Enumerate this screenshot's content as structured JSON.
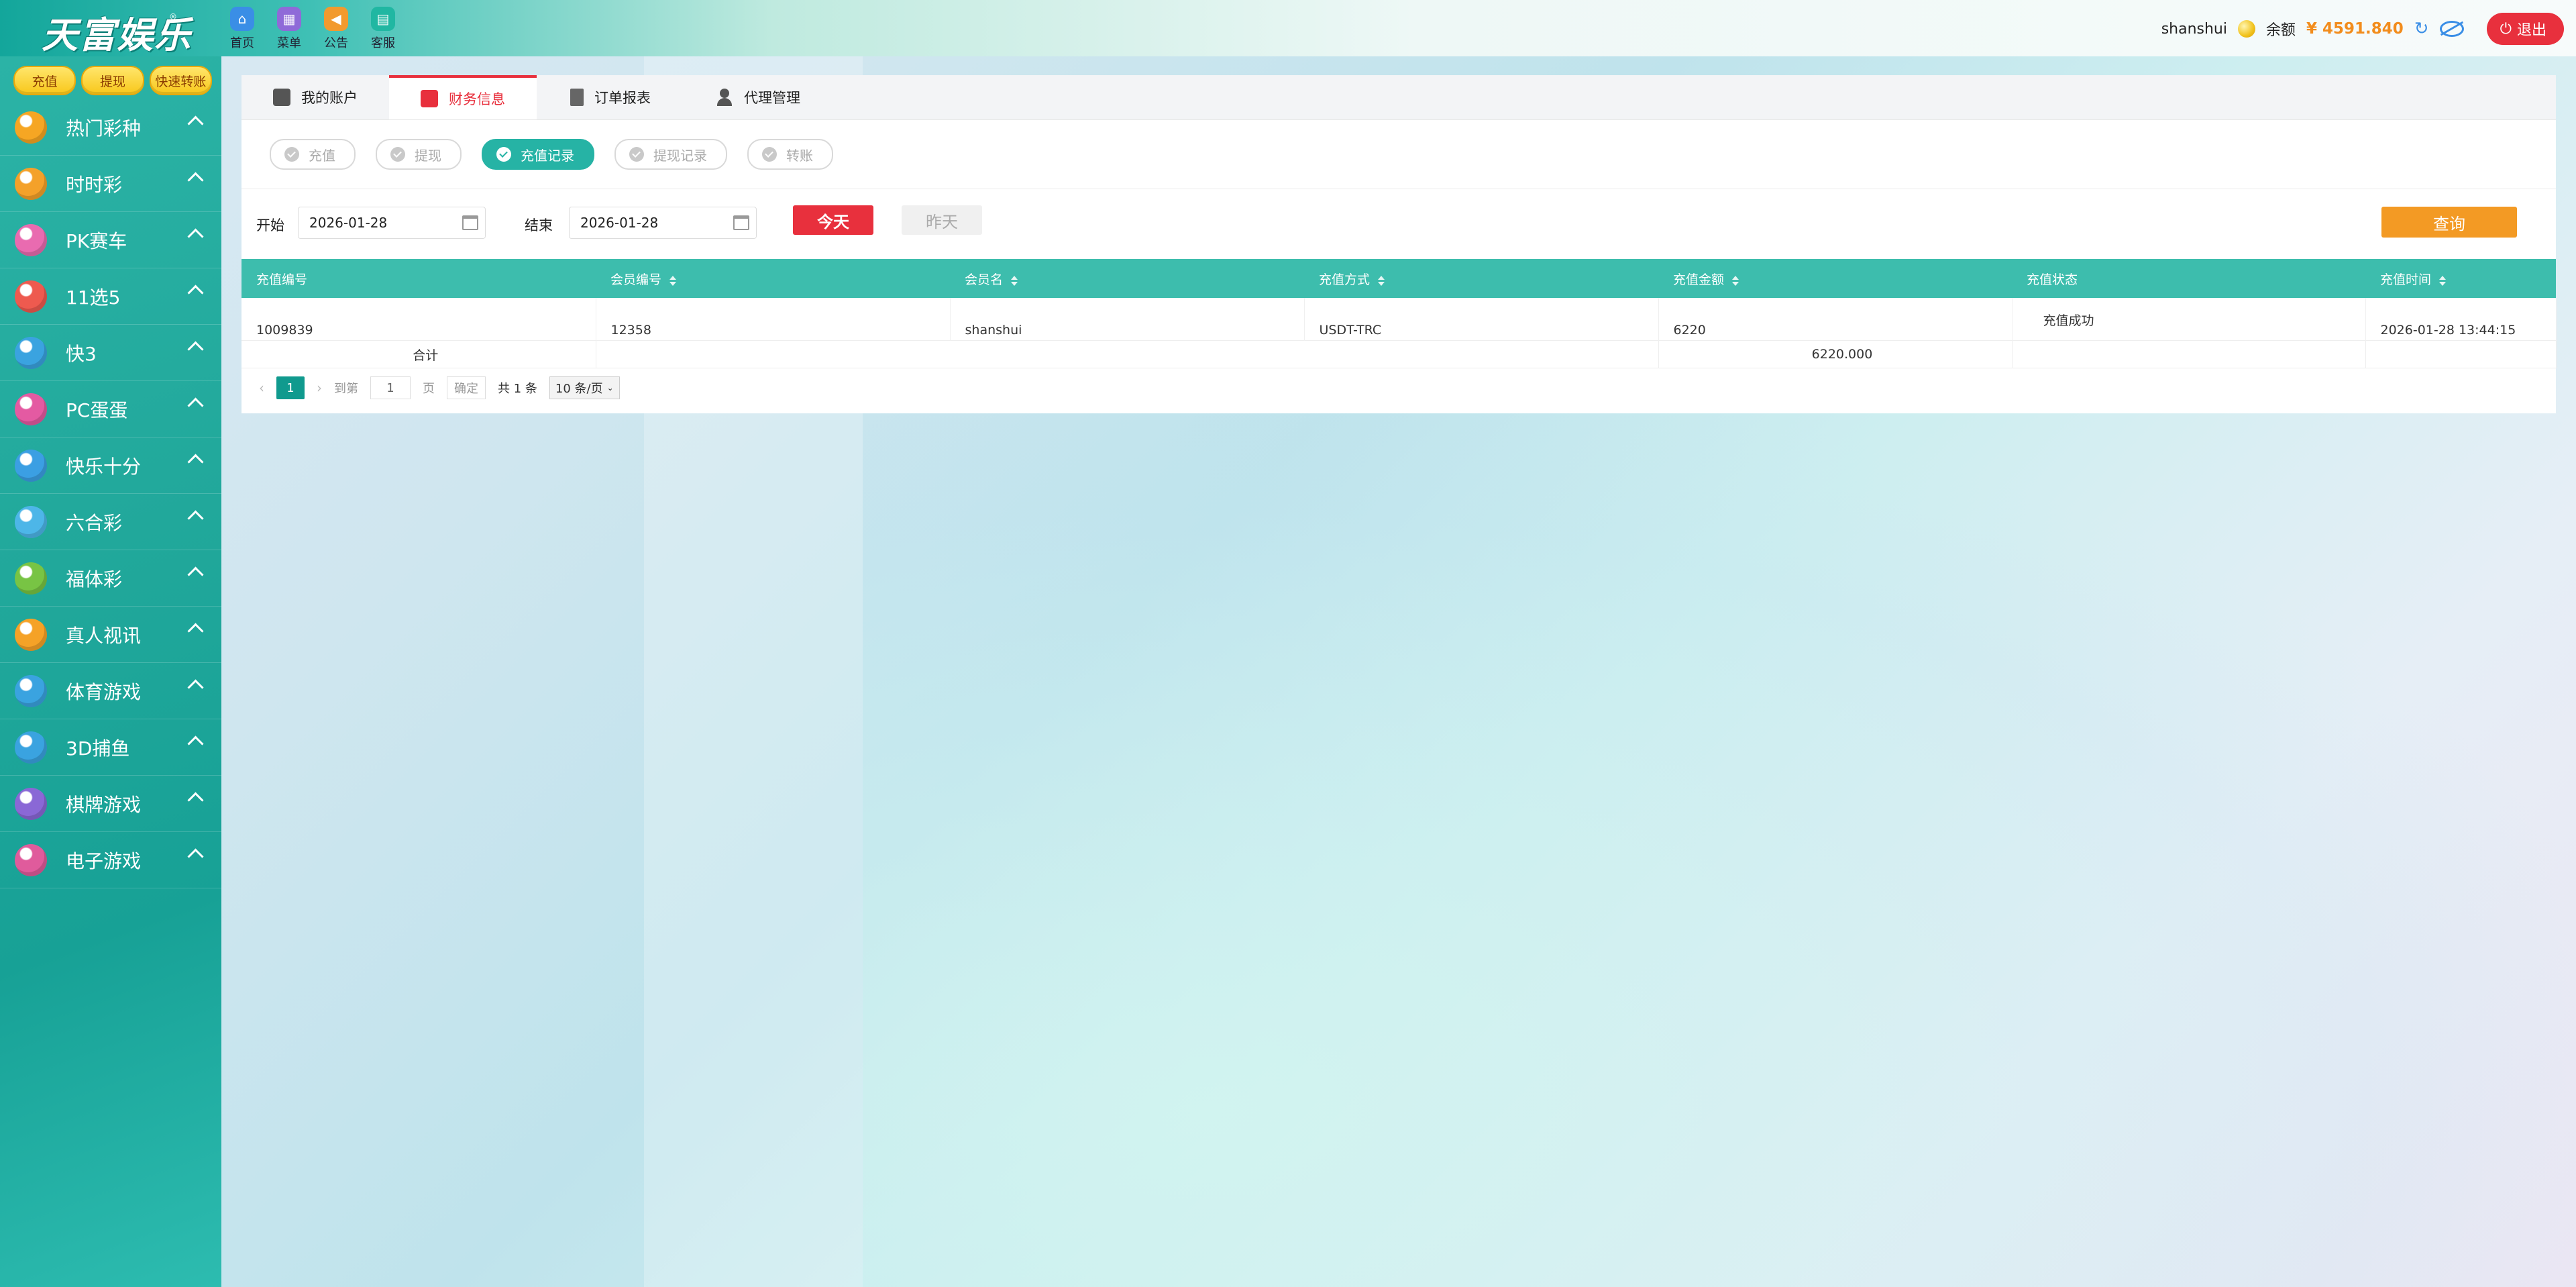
{
  "app": {
    "logo": "天富娱乐",
    "logo_reg": "®"
  },
  "topnav": [
    {
      "label": "首页",
      "icon": "home-icon"
    },
    {
      "label": "菜单",
      "icon": "grid-menu-icon"
    },
    {
      "label": "公告",
      "icon": "megaphone-icon"
    },
    {
      "label": "客服",
      "icon": "chat-icon"
    }
  ],
  "user": {
    "name": "shanshui",
    "balance_label": "余额",
    "balance": "¥ 4591.840",
    "logout": "退出"
  },
  "quick": {
    "deposit": "充值",
    "withdraw": "提现",
    "transfer": "快速转账"
  },
  "sidebar": {
    "items": [
      {
        "label": "热门彩种",
        "color": "#f6a623"
      },
      {
        "label": "时时彩",
        "color": "#f4a12a"
      },
      {
        "label": "PK赛车",
        "color": "#e96bb0"
      },
      {
        "label": "11选5",
        "color": "#ee5a4f"
      },
      {
        "label": "快3",
        "color": "#3aa3e0"
      },
      {
        "label": "PC蛋蛋",
        "color": "#e45aa2"
      },
      {
        "label": "快乐十分",
        "color": "#3b9fe3"
      },
      {
        "label": "六合彩",
        "color": "#4db6e8"
      },
      {
        "label": "福体彩",
        "color": "#78c444"
      },
      {
        "label": "真人视讯",
        "color": "#f5a227"
      },
      {
        "label": "体育游戏",
        "color": "#3aa3e0"
      },
      {
        "label": "3D捕鱼",
        "color": "#3aa3e0"
      },
      {
        "label": "棋牌游戏",
        "color": "#8a68d6"
      },
      {
        "label": "电子游戏",
        "color": "#e05b9c"
      }
    ]
  },
  "tabs": [
    {
      "label": "我的账户"
    },
    {
      "label": "财务信息"
    },
    {
      "label": "订单报表"
    },
    {
      "label": "代理管理"
    }
  ],
  "subtabs": [
    {
      "label": "充值"
    },
    {
      "label": "提现"
    },
    {
      "label": "充值记录"
    },
    {
      "label": "提现记录"
    },
    {
      "label": "转账"
    }
  ],
  "filter": {
    "start_label": "开始",
    "start_date": "2026-01-28",
    "end_label": "结束",
    "end_date": "2026-01-28",
    "today": "今天",
    "yesterday": "昨天",
    "query": "查询"
  },
  "table": {
    "columns": [
      "充值编号",
      "会员编号",
      "会员名",
      "充值方式",
      "充值金额",
      "充值状态",
      "充值时间"
    ],
    "rows": [
      [
        "1009839",
        "12358",
        "shanshui",
        "USDT-TRC",
        "6220",
        "充值成功",
        "2026-01-28 13:44:15"
      ]
    ],
    "summary_label": "合计",
    "summary_amount": "6220.000"
  },
  "pager": {
    "current": "1",
    "goto": "到第",
    "page_input": "1",
    "page_unit": "页",
    "confirm": "确定",
    "total": "共 1 条",
    "page_size": "10 条/页"
  }
}
